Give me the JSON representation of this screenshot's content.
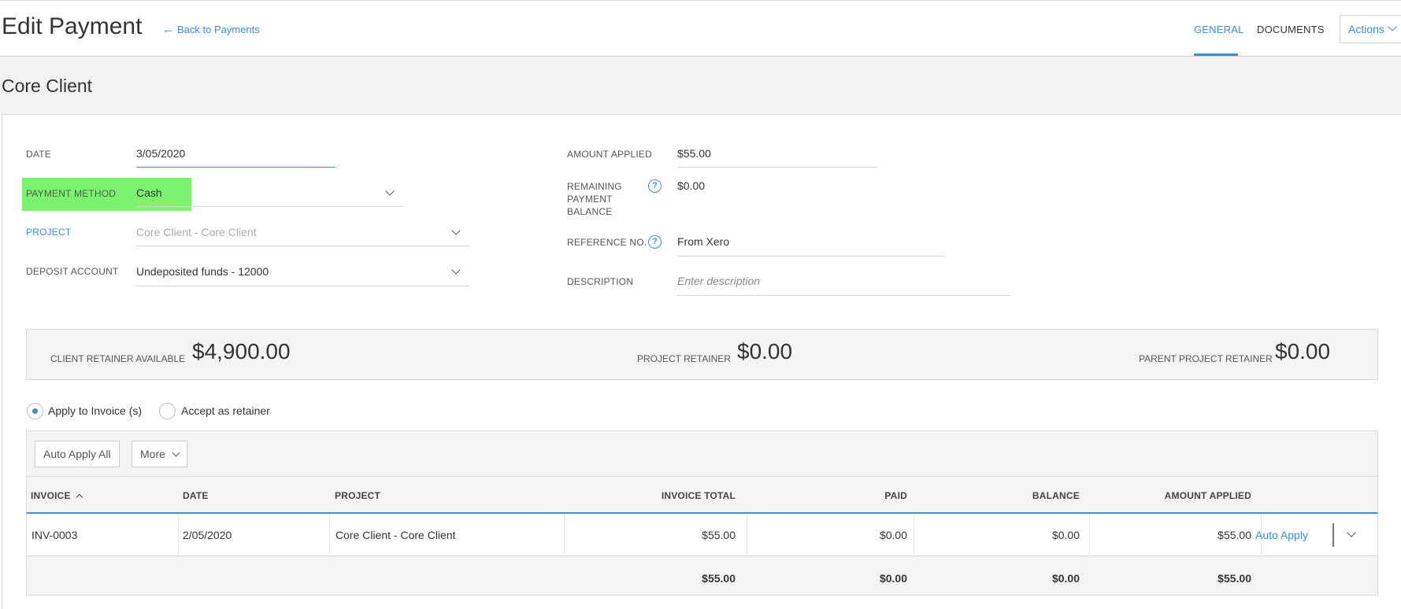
{
  "header": {
    "title": "Edit Payment",
    "back_label": "Back to Payments",
    "tabs": [
      {
        "label": "GENERAL",
        "active": true
      },
      {
        "label": "DOCUMENTS",
        "active": false
      }
    ],
    "actions_label": "Actions"
  },
  "client_name": "Core Client",
  "form": {
    "date": {
      "label": "DATE",
      "value": "3/05/2020"
    },
    "payment_method": {
      "label": "PAYMENT METHOD",
      "value": "Cash"
    },
    "project": {
      "label": "PROJECT",
      "value": "Core Client - Core Client"
    },
    "deposit_account": {
      "label": "DEPOSIT ACCOUNT",
      "value": "Undeposited  funds - 12000"
    },
    "amount_applied": {
      "label": "AMOUNT APPLIED",
      "value": "$55.00"
    },
    "remaining_balance": {
      "label_lines": [
        "REMAINING",
        "PAYMENT",
        "BALANCE"
      ],
      "value": "$0.00",
      "help": "?"
    },
    "reference_no": {
      "label": "REFERENCE NO.",
      "value": "From Xero",
      "help": "?"
    },
    "description": {
      "label": "DESCRIPTION",
      "placeholder": "Enter description"
    }
  },
  "retainers": {
    "client": {
      "label": "CLIENT RETAINER AVAILABLE",
      "value": "$4,900.00"
    },
    "project": {
      "label": "PROJECT RETAINER",
      "value": "$0.00"
    },
    "parent_project": {
      "label": "PARENT PROJECT RETAINER",
      "value": "$0.00"
    }
  },
  "apply_options": [
    {
      "label": "Apply to Invoice (s)",
      "selected": true
    },
    {
      "label": "Accept as retainer",
      "selected": false
    }
  ],
  "toolbar": {
    "auto_apply_all": "Auto Apply All",
    "more": "More"
  },
  "table": {
    "columns": [
      "INVOICE",
      "DATE",
      "PROJECT",
      "INVOICE TOTAL",
      "PAID",
      "BALANCE",
      "AMOUNT APPLIED"
    ],
    "rows": [
      {
        "invoice": "INV-0003",
        "date": "2/05/2020",
        "project": "Core Client - Core Client",
        "invoice_total": "$55.00",
        "paid": "$0.00",
        "balance": "$0.00",
        "amount_applied": "$55.00",
        "action": "Auto Apply"
      }
    ],
    "totals": {
      "invoice_total": "$55.00",
      "paid": "$0.00",
      "balance": "$0.00",
      "amount_applied": "$55.00"
    }
  },
  "colors": {
    "accent": "#3a8fd6",
    "highlight": "#7bf36f"
  },
  "icons": [
    "back-arrow-icon",
    "chevron-down-icon",
    "help-icon",
    "sort-ascending-icon",
    "radio-selected-icon"
  ]
}
